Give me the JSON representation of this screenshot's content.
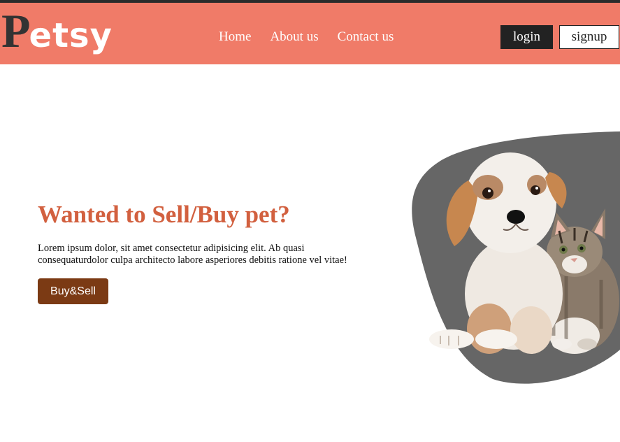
{
  "brand": {
    "logo_initial": "P",
    "logo_rest": "etsy"
  },
  "nav": {
    "items": [
      {
        "label": "Home"
      },
      {
        "label": "About us"
      },
      {
        "label": "Contact us"
      }
    ]
  },
  "auth": {
    "login_label": "login",
    "signup_label": "signup"
  },
  "hero": {
    "title": "Wanted to Sell/Buy pet?",
    "text": "Lorem ipsum dolor, sit amet consectetur adipisicing elit. Ab quasi consequaturdolor culpa architecto labore asperiores debitis ratione vel vitae!",
    "cta_label": "Buy&Sell"
  },
  "colors": {
    "header_bg": "#f07b68",
    "title": "#d2603f",
    "cta_bg": "#7b3a14",
    "blob": "#666666"
  },
  "icons": {
    "hero_image": "puppy-and-kitten-illustration"
  }
}
